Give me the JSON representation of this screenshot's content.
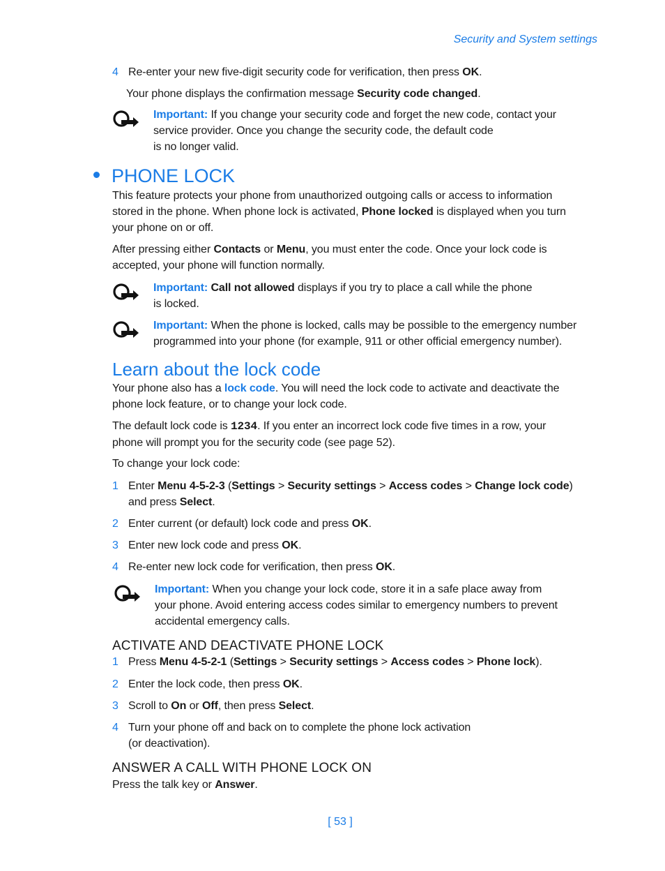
{
  "header": {
    "section_title": "Security and System settings"
  },
  "security_steps": [
    {
      "num": "4",
      "pre": "Re-enter your new five-digit security code for verification, then press ",
      "bold": "OK",
      "post": "."
    }
  ],
  "confirmation": {
    "pre": "Your phone displays the confirmation message ",
    "bold": "Security code changed",
    "post": "."
  },
  "note1": {
    "label": "Important:",
    "line1": " If you change your security code and forget the new code, contact your",
    "line2": "service provider. Once you change the security code, the default code",
    "line3": "is no longer valid."
  },
  "phone_lock": {
    "title": "PHONE LOCK",
    "para1": {
      "a": "This feature protects your phone from unauthorized outgoing calls or access to information",
      "b": "stored in the phone. When phone lock is activated, ",
      "bold": "Phone locked",
      "c": " is displayed when you turn",
      "d": "your phone on or off."
    },
    "para2": {
      "a": "After pressing either ",
      "bold1": "Contacts",
      "b": " or ",
      "bold2": "Menu",
      "c": ", you must enter the code. Once your lock code is",
      "d": "accepted, your phone will function normally."
    },
    "note2": {
      "label": "Important:",
      "bold": " Call not allowed",
      "rest": " displays if you try to place a call while the phone",
      "line2": "is locked."
    },
    "note3": {
      "label": "Important:",
      "rest": " When the phone is locked, calls may be possible to the emergency number",
      "line2": "programmed into your phone (for example, 911 or other official emergency number)."
    }
  },
  "lock_code": {
    "title": "Learn about the lock code",
    "para1": {
      "a": "Your phone also has a ",
      "link": "lock code",
      "b": ". You will need the lock code to activate and deactivate the",
      "c": "phone lock feature, or to change your lock code."
    },
    "para2": {
      "a": "The default lock code is ",
      "code": "1234",
      "b": ". If you enter an incorrect lock code five times in a row, your",
      "c": "phone will prompt you for the security code (see page 52)."
    },
    "para3": "To change your lock code:",
    "steps": [
      {
        "num": "1",
        "t1": "Enter ",
        "b1": "Menu 4-5-2-3",
        "t2": " (",
        "b2": "Settings",
        "t3": " > ",
        "b3": "Security settings",
        "t4": " > ",
        "b4": "Access codes",
        "t5": " > ",
        "b5": "Change lock code",
        "t6": ")",
        "line2a": "and press ",
        "line2b": "Select",
        "line2c": "."
      },
      {
        "num": "2",
        "pre": "Enter current (or default) lock code and press ",
        "bold": "OK",
        "post": "."
      },
      {
        "num": "3",
        "pre": "Enter new lock code and press ",
        "bold": "OK",
        "post": "."
      },
      {
        "num": "4",
        "pre": "Re-enter new lock code for verification, then press ",
        "bold": "OK",
        "post": "."
      }
    ],
    "note4": {
      "label": "Important:",
      "rest": " When you change your lock code, store it in a safe place away from",
      "line2": "your phone. Avoid entering access codes similar to emergency numbers to prevent",
      "line3": "accidental emergency calls."
    }
  },
  "activate": {
    "title": "ACTIVATE AND DEACTIVATE PHONE LOCK",
    "steps": [
      {
        "num": "1",
        "t1": "Press ",
        "b1": "Menu 4-5-2-1",
        "t2": " (",
        "b2": "Settings",
        "t3": " > ",
        "b3": "Security settings",
        "t4": " > ",
        "b4": "Access codes",
        "t5": " > ",
        "b5": "Phone lock",
        "t6": ")."
      },
      {
        "num": "2",
        "pre": "Enter the lock code, then press ",
        "bold": "OK",
        "post": "."
      },
      {
        "num": "3",
        "t1": "Scroll to ",
        "b1": "On",
        "t2": " or ",
        "b2": "Off",
        "t3": ", then press ",
        "b3": "Select",
        "t4": "."
      },
      {
        "num": "4",
        "line1": "Turn your phone off and back on to complete the phone lock activation",
        "line2": "(or deactivation)."
      }
    ]
  },
  "answer": {
    "title": "ANSWER A CALL WITH PHONE LOCK ON",
    "pre": "Press the talk key or ",
    "bold": "Answer",
    "post": "."
  },
  "footer": {
    "page_number": "[ 53 ]"
  },
  "icons": {
    "note_icon": "important-note-icon"
  }
}
